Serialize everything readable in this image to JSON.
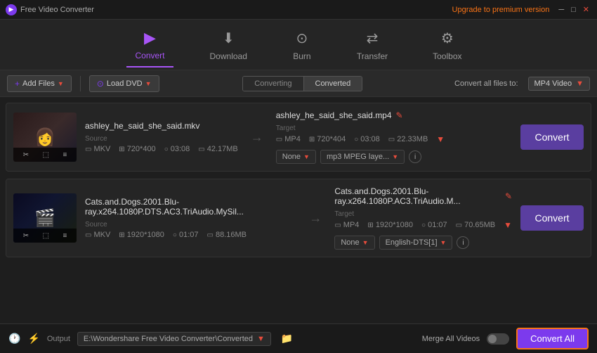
{
  "titlebar": {
    "app_name": "Free Video Converter",
    "upgrade_text": "Upgrade to premium version",
    "logo_char": "▶"
  },
  "nav": {
    "items": [
      {
        "id": "convert",
        "label": "Convert",
        "icon": "▶",
        "active": true
      },
      {
        "id": "download",
        "label": "Download",
        "icon": "⬇",
        "active": false
      },
      {
        "id": "burn",
        "label": "Burn",
        "icon": "⊙",
        "active": false
      },
      {
        "id": "transfer",
        "label": "Transfer",
        "icon": "⇄",
        "active": false
      },
      {
        "id": "toolbox",
        "label": "Toolbox",
        "icon": "⚙",
        "active": false
      }
    ]
  },
  "toolbar": {
    "add_files": "+ Add Files",
    "load_dvd": "⊙ Load DVD",
    "tab_converting": "Converting",
    "tab_converted": "Converted",
    "convert_all_label": "Convert all files to:",
    "format": "MP4 Video"
  },
  "files": [
    {
      "id": "file1",
      "source_name": "ashley_he_said_she_said.mkv",
      "source_format": "MKV",
      "source_resolution": "720*400",
      "source_duration": "03:08",
      "source_size": "42.17MB",
      "target_name": "ashley_he_said_she_said.mp4",
      "target_format": "MP4",
      "target_resolution": "720*404",
      "target_duration": "03:08",
      "target_size": "22.33MB",
      "subtitle": "None",
      "audio": "mp3 MPEG laye...",
      "convert_btn": "Convert"
    },
    {
      "id": "file2",
      "source_name": "Cats.and.Dogs.2001.Blu-ray.x264.1080P.DTS.AC3.TriAudio.MySil...",
      "source_format": "MKV",
      "source_resolution": "1920*1080",
      "source_duration": "01:07",
      "source_size": "88.16MB",
      "target_name": "Cats.and.Dogs.2001.Blu-ray.x264.1080P.AC3.TriAudio.M...",
      "target_format": "MP4",
      "target_resolution": "1920*1080",
      "target_duration": "01:07",
      "target_size": "70.65MB",
      "subtitle": "None",
      "audio": "English-DTS[1]",
      "convert_btn": "Convert"
    }
  ],
  "statusbar": {
    "output_label": "Output",
    "output_path": "E:\\Wondershare Free Video Converter\\Converted",
    "merge_label": "Merge All Videos",
    "convert_all_btn": "Convert All"
  },
  "icons": {
    "plus": "+",
    "disk": "💿",
    "arrow_right": "→",
    "edit": "✎",
    "chevron_down": "▼",
    "info": "i",
    "clock": "🕐",
    "lightning": "⚡",
    "folder": "📁",
    "scissors": "✂",
    "crop": "⬚",
    "list": "≡",
    "film": "🎬"
  },
  "source_label": "Source",
  "target_label": "Target"
}
